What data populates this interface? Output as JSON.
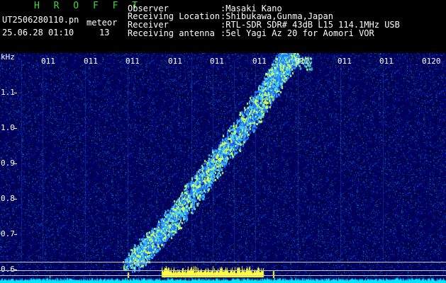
{
  "header": {
    "brand": "H R O F F T",
    "filename": "UT2506280110.pn",
    "meteor_label": "meteor",
    "datetime": "25.06.28 01:10",
    "count": "13",
    "rows": [
      {
        "label": "Observer",
        "value": ":Masaki Kano"
      },
      {
        "label": "Receiving Location",
        "value": ":Shibukawa,Gunma,Japan"
      },
      {
        "label": "Receiver",
        "value": ":RTL-SDR SDR# 43dB L15 114.1MHz USB"
      },
      {
        "label": "Receiving antenna",
        "value": ":5el Yagi Az 20 for Aomori VOR"
      }
    ]
  },
  "plot": {
    "y_unit": "kHz",
    "y_ticks": [
      "1.1",
      "1.0",
      "0.9",
      "0.8",
      "0.7",
      "0.6"
    ],
    "x_ticks": [
      "011",
      "011",
      "011",
      "011",
      "011",
      "011",
      "011",
      "011",
      "011",
      "0120"
    ],
    "colors": {
      "background": "#001a6e",
      "signal_green": "#7dff7d",
      "trace_cyan": "#00e5ff",
      "trace_yellow": "#ffff33"
    }
  }
}
